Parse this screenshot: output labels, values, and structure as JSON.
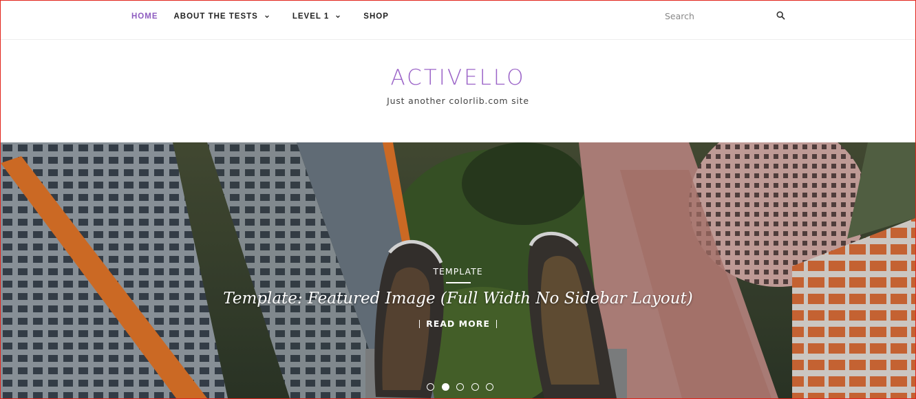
{
  "nav": {
    "items": [
      {
        "label": "HOME",
        "active": true
      },
      {
        "label": "ABOUT THE TESTS",
        "dropdown": true
      },
      {
        "label": "LEVEL 1",
        "dropdown": true
      },
      {
        "label": "SHOP"
      }
    ],
    "search_placeholder": "Search",
    "search_icon": "search-icon",
    "dropdown_icon": "chevron-down-icon"
  },
  "branding": {
    "logo": "ACTIVELLO",
    "tagline": "Just another colorlib.com site"
  },
  "hero": {
    "category": "TEMPLATE",
    "title": "Template: Featured Image (Full Width No Sidebar Layout)",
    "read_more": "READ MORE",
    "slides_count": 5,
    "active_slide": 2
  },
  "colors": {
    "accent": "#8e5cc0",
    "logo": "#9b64c8",
    "nav_text": "#222222",
    "frame_border": "#e2231a"
  }
}
